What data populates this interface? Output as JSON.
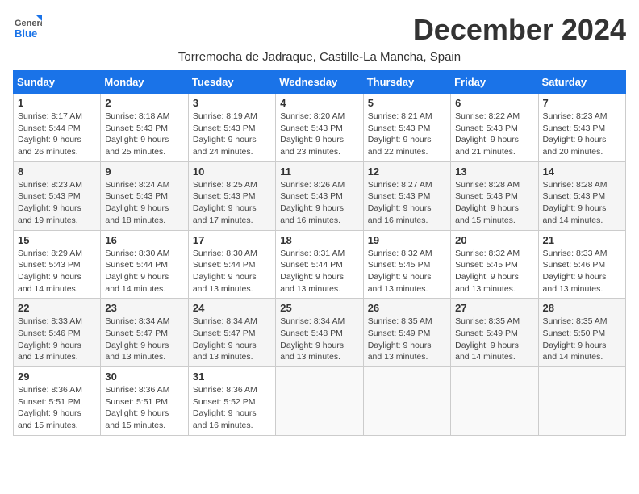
{
  "header": {
    "logo_general": "General",
    "logo_blue": "Blue",
    "month_title": "December 2024",
    "location": "Torremocha de Jadraque, Castille-La Mancha, Spain"
  },
  "calendar": {
    "days_of_week": [
      "Sunday",
      "Monday",
      "Tuesday",
      "Wednesday",
      "Thursday",
      "Friday",
      "Saturday"
    ],
    "weeks": [
      [
        {
          "day": "",
          "info": ""
        },
        {
          "day": "2",
          "info": "Sunrise: 8:18 AM\nSunset: 5:43 PM\nDaylight: 9 hours and 25 minutes."
        },
        {
          "day": "3",
          "info": "Sunrise: 8:19 AM\nSunset: 5:43 PM\nDaylight: 9 hours and 24 minutes."
        },
        {
          "day": "4",
          "info": "Sunrise: 8:20 AM\nSunset: 5:43 PM\nDaylight: 9 hours and 23 minutes."
        },
        {
          "day": "5",
          "info": "Sunrise: 8:21 AM\nSunset: 5:43 PM\nDaylight: 9 hours and 22 minutes."
        },
        {
          "day": "6",
          "info": "Sunrise: 8:22 AM\nSunset: 5:43 PM\nDaylight: 9 hours and 21 minutes."
        },
        {
          "day": "7",
          "info": "Sunrise: 8:23 AM\nSunset: 5:43 PM\nDaylight: 9 hours and 20 minutes."
        }
      ],
      [
        {
          "day": "8",
          "info": "Sunrise: 8:23 AM\nSunset: 5:43 PM\nDaylight: 9 hours and 19 minutes."
        },
        {
          "day": "9",
          "info": "Sunrise: 8:24 AM\nSunset: 5:43 PM\nDaylight: 9 hours and 18 minutes."
        },
        {
          "day": "10",
          "info": "Sunrise: 8:25 AM\nSunset: 5:43 PM\nDaylight: 9 hours and 17 minutes."
        },
        {
          "day": "11",
          "info": "Sunrise: 8:26 AM\nSunset: 5:43 PM\nDaylight: 9 hours and 16 minutes."
        },
        {
          "day": "12",
          "info": "Sunrise: 8:27 AM\nSunset: 5:43 PM\nDaylight: 9 hours and 16 minutes."
        },
        {
          "day": "13",
          "info": "Sunrise: 8:28 AM\nSunset: 5:43 PM\nDaylight: 9 hours and 15 minutes."
        },
        {
          "day": "14",
          "info": "Sunrise: 8:28 AM\nSunset: 5:43 PM\nDaylight: 9 hours and 14 minutes."
        }
      ],
      [
        {
          "day": "15",
          "info": "Sunrise: 8:29 AM\nSunset: 5:43 PM\nDaylight: 9 hours and 14 minutes."
        },
        {
          "day": "16",
          "info": "Sunrise: 8:30 AM\nSunset: 5:44 PM\nDaylight: 9 hours and 14 minutes."
        },
        {
          "day": "17",
          "info": "Sunrise: 8:30 AM\nSunset: 5:44 PM\nDaylight: 9 hours and 13 minutes."
        },
        {
          "day": "18",
          "info": "Sunrise: 8:31 AM\nSunset: 5:44 PM\nDaylight: 9 hours and 13 minutes."
        },
        {
          "day": "19",
          "info": "Sunrise: 8:32 AM\nSunset: 5:45 PM\nDaylight: 9 hours and 13 minutes."
        },
        {
          "day": "20",
          "info": "Sunrise: 8:32 AM\nSunset: 5:45 PM\nDaylight: 9 hours and 13 minutes."
        },
        {
          "day": "21",
          "info": "Sunrise: 8:33 AM\nSunset: 5:46 PM\nDaylight: 9 hours and 13 minutes."
        }
      ],
      [
        {
          "day": "22",
          "info": "Sunrise: 8:33 AM\nSunset: 5:46 PM\nDaylight: 9 hours and 13 minutes."
        },
        {
          "day": "23",
          "info": "Sunrise: 8:34 AM\nSunset: 5:47 PM\nDaylight: 9 hours and 13 minutes."
        },
        {
          "day": "24",
          "info": "Sunrise: 8:34 AM\nSunset: 5:47 PM\nDaylight: 9 hours and 13 minutes."
        },
        {
          "day": "25",
          "info": "Sunrise: 8:34 AM\nSunset: 5:48 PM\nDaylight: 9 hours and 13 minutes."
        },
        {
          "day": "26",
          "info": "Sunrise: 8:35 AM\nSunset: 5:49 PM\nDaylight: 9 hours and 13 minutes."
        },
        {
          "day": "27",
          "info": "Sunrise: 8:35 AM\nSunset: 5:49 PM\nDaylight: 9 hours and 14 minutes."
        },
        {
          "day": "28",
          "info": "Sunrise: 8:35 AM\nSunset: 5:50 PM\nDaylight: 9 hours and 14 minutes."
        }
      ],
      [
        {
          "day": "29",
          "info": "Sunrise: 8:36 AM\nSunset: 5:51 PM\nDaylight: 9 hours and 15 minutes."
        },
        {
          "day": "30",
          "info": "Sunrise: 8:36 AM\nSunset: 5:51 PM\nDaylight: 9 hours and 15 minutes."
        },
        {
          "day": "31",
          "info": "Sunrise: 8:36 AM\nSunset: 5:52 PM\nDaylight: 9 hours and 16 minutes."
        },
        {
          "day": "",
          "info": ""
        },
        {
          "day": "",
          "info": ""
        },
        {
          "day": "",
          "info": ""
        },
        {
          "day": "",
          "info": ""
        }
      ]
    ],
    "first_week_sunday": {
      "day": "1",
      "info": "Sunrise: 8:17 AM\nSunset: 5:44 PM\nDaylight: 9 hours and 26 minutes."
    }
  }
}
